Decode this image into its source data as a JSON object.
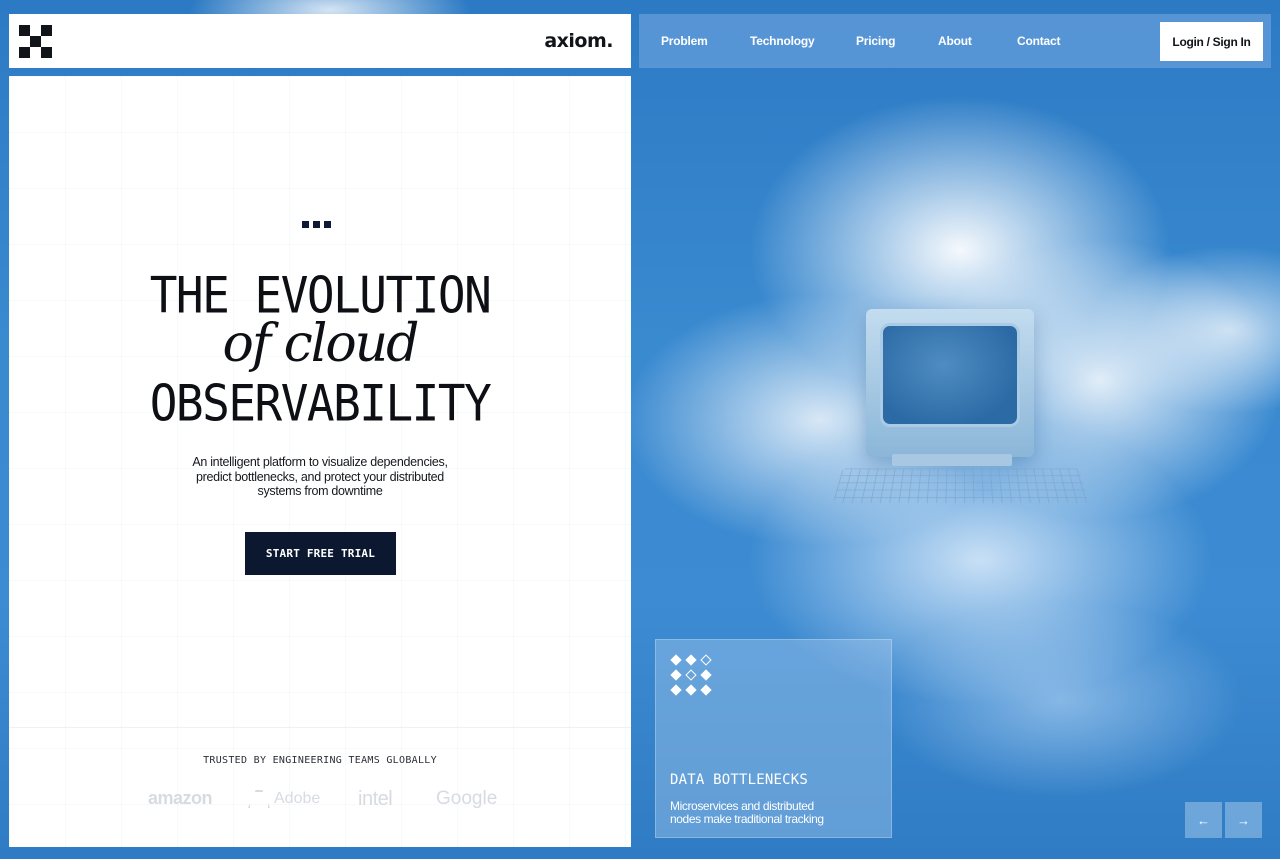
{
  "brand": {
    "name": "axiom."
  },
  "nav": {
    "links": [
      "Problem",
      "Technology",
      "Pricing",
      "About",
      "Contact"
    ],
    "login_label": "Login / Sign In"
  },
  "hero": {
    "headline_line1": "THE EVOLUTION",
    "headline_line2": "of cloud",
    "headline_line3": "OBSERVABILITY",
    "subtext": "An intelligent platform to visualize dependencies, predict bottlenecks, and protect your distributed systems from downtime",
    "cta_label": "START FREE TRIAL"
  },
  "trusted": {
    "label": "TRUSTED BY ENGINEERING TEAMS GLOBALLY",
    "logos": [
      "amazon",
      "Adobe",
      "intel",
      "Google"
    ]
  },
  "info_card": {
    "title": "DATA BOTTLENECKS",
    "text": "Microservices and distributed nodes make traditional tracking"
  },
  "carousel": {
    "prev_icon": "←",
    "next_icon": "→"
  },
  "colors": {
    "sky_blue": "#2f7fc6",
    "cta_navy": "#0c1830",
    "text_dark": "#0d0f14"
  },
  "icons": [
    "logo-mark-icon",
    "diamond-grid-icon",
    "arrow-left-icon",
    "arrow-right-icon"
  ]
}
